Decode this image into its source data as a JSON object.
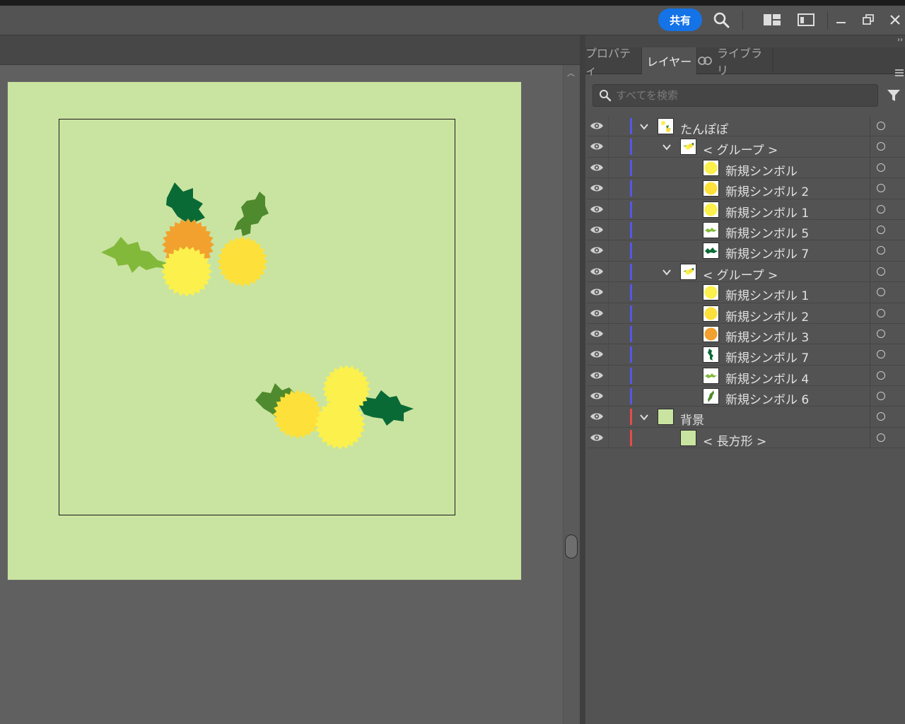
{
  "titlebar": {
    "share_label": "共有",
    "icons": [
      "search-icon",
      "arrange-documents-icon",
      "workspace-icon",
      "minimize-icon",
      "restore-icon",
      "close-icon"
    ]
  },
  "panel": {
    "tabs": [
      {
        "label": "プロパティ",
        "active": false
      },
      {
        "label": "レイヤー",
        "active": true
      },
      {
        "label": "ライブラリ",
        "active": false
      }
    ],
    "search_placeholder": "すべてを検索",
    "layers": [
      {
        "name": "たんぽぽ",
        "depth": 0,
        "expand": "down",
        "color": "#5656e8",
        "thumb": "layer"
      },
      {
        "name": "< グループ >",
        "depth": 1,
        "expand": "down",
        "color": "#5656e8",
        "thumb": "group"
      },
      {
        "name": "新規シンボル",
        "depth": 2,
        "expand": "none",
        "color": "#5656e8",
        "thumb": "flower-yellow"
      },
      {
        "name": "新規シンボル 2",
        "depth": 2,
        "expand": "none",
        "color": "#5656e8",
        "thumb": "flower-gold"
      },
      {
        "name": "新規シンボル 1",
        "depth": 2,
        "expand": "none",
        "color": "#5656e8",
        "thumb": "flower-yellow"
      },
      {
        "name": "新規シンボル 5",
        "depth": 2,
        "expand": "none",
        "color": "#5656e8",
        "thumb": "leaf-light"
      },
      {
        "name": "新規シンボル 7",
        "depth": 2,
        "expand": "none",
        "color": "#5656e8",
        "thumb": "leaf-dark"
      },
      {
        "name": "< グループ >",
        "depth": 1,
        "expand": "down",
        "color": "#5656e8",
        "thumb": "group"
      },
      {
        "name": "新規シンボル 1",
        "depth": 2,
        "expand": "none",
        "color": "#5656e8",
        "thumb": "flower-yellow"
      },
      {
        "name": "新規シンボル 2",
        "depth": 2,
        "expand": "none",
        "color": "#5656e8",
        "thumb": "flower-gold"
      },
      {
        "name": "新規シンボル 3",
        "depth": 2,
        "expand": "none",
        "color": "#5656e8",
        "thumb": "flower-orange"
      },
      {
        "name": "新規シンボル 7",
        "depth": 2,
        "expand": "none",
        "color": "#5656e8",
        "thumb": "leaf-vertical"
      },
      {
        "name": "新規シンボル 4",
        "depth": 2,
        "expand": "none",
        "color": "#5656e8",
        "thumb": "leaf-light"
      },
      {
        "name": "新規シンボル 6",
        "depth": 2,
        "expand": "none",
        "color": "#5656e8",
        "thumb": "leaf-diag"
      },
      {
        "name": "背景",
        "depth": 0,
        "expand": "down",
        "color": "#e84a4a",
        "thumb": "bg"
      },
      {
        "name": "< 長方形 >",
        "depth": 1,
        "expand": "none",
        "color": "#e84a4a",
        "thumb": "bg"
      }
    ]
  },
  "colors": {
    "artboard": "#c9e4a0",
    "dandelion_yellow": "#fbf04c",
    "dandelion_gold": "#fde03a",
    "dandelion_orange": "#f2a12e",
    "leaf_light": "#83b93b",
    "leaf_mid": "#4f8a2e",
    "leaf_dark": "#0a6a36",
    "layer_color_blue": "#5656e8",
    "layer_color_red": "#e84a4a",
    "accent_blue": "#1473e6"
  }
}
